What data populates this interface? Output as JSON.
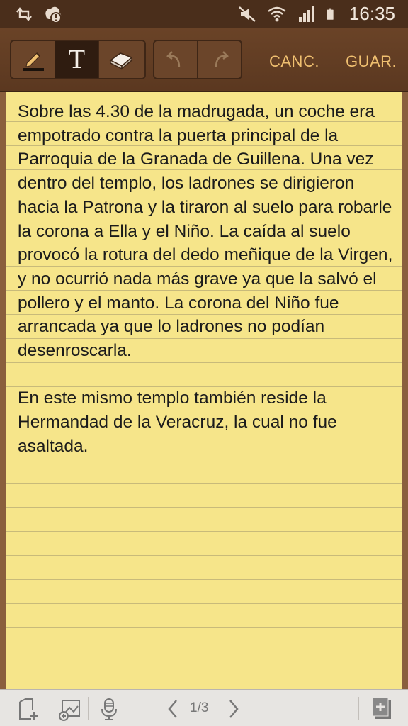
{
  "status_bar": {
    "time": "16:35",
    "left_icons": [
      "sync-icon",
      "alert-icon"
    ],
    "right_icons": [
      "mute-icon",
      "wifi-icon",
      "signal-icon",
      "battery-icon"
    ]
  },
  "toolbar": {
    "tools": [
      {
        "name": "pen-icon",
        "state": "normal"
      },
      {
        "name": "text-icon",
        "label": "T",
        "state": "active"
      },
      {
        "name": "eraser-icon",
        "state": "normal"
      }
    ],
    "history": [
      "undo-icon",
      "redo-icon"
    ],
    "cancel_label": "CANC.",
    "save_label": "GUAR.",
    "accent_color": "#f0c070"
  },
  "note": {
    "paragraphs": [
      "Sobre las 4.30 de la madrugada, un coche era empotrado contra la puerta principal de la Parroquia de la Granada de Guillena. Una vez dentro del templo, los ladrones se dirigieron hacia la Patrona y la tiraron al suelo para robarle la corona a Ella y el Niño. La caída al suelo provocó la rotura del dedo meñique de la Virgen, y no ocurrió nada más grave ya que la salvó el pollero y el manto. La corona del Niño fue arrancada ya que lo ladrones no podían desenroscarla.",
      "En este mismo templo también reside la Hermandad de la Veracruz, la cual no fue asaltada."
    ],
    "paper_color": "#f6e58a"
  },
  "bottom_bar": {
    "page_indicator": "1/3",
    "icons": [
      "add-page-icon",
      "insert-image-icon",
      "microphone-icon",
      "prev-page-icon",
      "next-page-icon",
      "new-note-icon"
    ]
  }
}
